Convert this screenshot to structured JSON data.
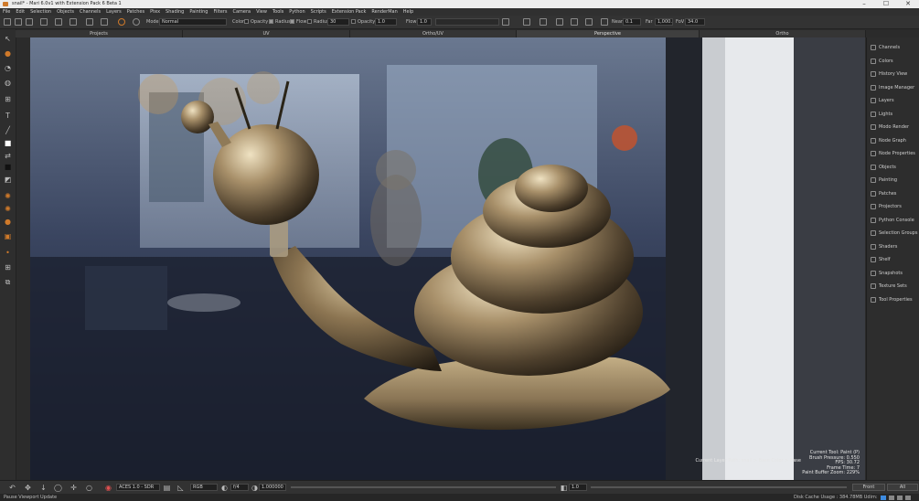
{
  "window": {
    "title": "snail* - Mari 6.0v1 with Extension Pack 6 Beta 1",
    "controls": {
      "minimize": "–",
      "maximize": "☐",
      "close": "✕"
    }
  },
  "menu": [
    "File",
    "Edit",
    "Selection",
    "Objects",
    "Channels",
    "Layers",
    "Patches",
    "Ptex",
    "Shading",
    "Painting",
    "Filters",
    "Camera",
    "View",
    "Tools",
    "Python",
    "Scripts",
    "Extension Pack",
    "RenderMan",
    "Help"
  ],
  "toolbar": {
    "mode_label": "Mode",
    "mode_value": "Normal",
    "color_label": "Color",
    "opacity_check_label": "Opacity",
    "radius_check_label": "Radius",
    "flow_check_label": "Flow",
    "radius_label": "Radius",
    "radius_value": "30",
    "opacity_label": "Opacity",
    "opacity_value": "1.0",
    "flow_label": "Flow",
    "flow_value": "1.0",
    "near_label": "Near",
    "near_value": "0.1",
    "far_label": "Far",
    "far_value": "1,000.0",
    "fov_label": "FoV",
    "fov_value": "34.0"
  },
  "tabs": [
    "Projects",
    "UV",
    "Ortho/UV",
    "Perspective",
    "Ortho"
  ],
  "active_tab": "Perspective",
  "right_panel": [
    "Channels",
    "Colors",
    "History View",
    "Image Manager",
    "Layers",
    "Lights",
    "Modo Render",
    "Node Graph",
    "Node Properties",
    "Objects",
    "Painting",
    "Patches",
    "Projectors",
    "Python Console",
    "Selection Groups",
    "Shaders",
    "Shelf",
    "Snapshots",
    "Texture Sets",
    "Tool Properties"
  ],
  "hud": {
    "path": "Current Layer Path: snail > Base Color > Base",
    "lines": [
      "Current Tool: Paint (P)",
      "Brush Pressure: 0.550",
      "FPS: 30.72",
      "Frame Time: 7",
      "Paint Buffer Zoom: 229%"
    ]
  },
  "bottombar": {
    "colorspace": "ACES 1.0 - SDR",
    "channel": "RGB",
    "exposure": "f/4",
    "gamma": "1.000000",
    "gain": "1.0",
    "front_label": "Front",
    "all_label": "All"
  },
  "status": {
    "message": "Pause Viewport Update",
    "cache": "Disk Cache Usage : 384.78MB  Udim:"
  },
  "colors": {
    "accent": "#d07a2a",
    "panel": "#2d2d2d",
    "bg": "#2b2b2b"
  }
}
